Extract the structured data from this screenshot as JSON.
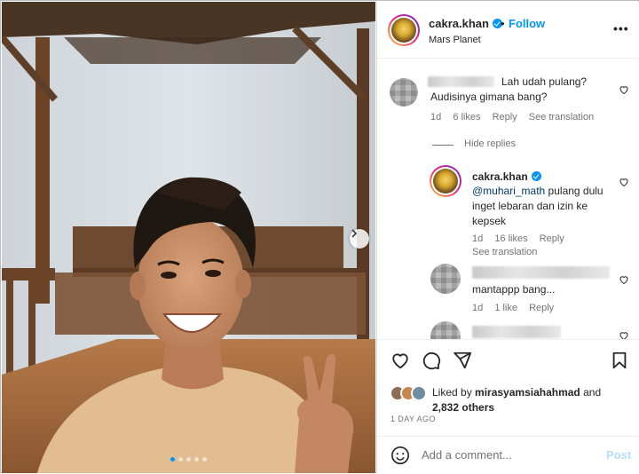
{
  "header": {
    "username": "cakra.khan",
    "separator": "•",
    "follow_label": "Follow",
    "location": "Mars Planet",
    "more_label": "•••"
  },
  "comments": [
    {
      "text": "Lah udah pulang? Audisinya gimana bang?",
      "age": "1d",
      "likes": "6 likes",
      "reply": "Reply",
      "translate": "See translation"
    }
  ],
  "hide_replies": "Hide replies",
  "reply": {
    "username": "cakra.khan",
    "mention": "@muhari_math",
    "text": " pulang dulu inget lebaran dan izin ke kepsek",
    "age": "1d",
    "likes": "16 likes",
    "reply": "Reply",
    "translate": "See translation"
  },
  "comment2": {
    "text": "mantappp bang...",
    "age": "1d",
    "likes": "1 like",
    "reply": "Reply"
  },
  "likes": {
    "prefix": "Liked by ",
    "user": "mirasyamsiahahmad",
    "middle": " and",
    "count": "2,832 others"
  },
  "timestamp": "1 DAY AGO",
  "add_comment": {
    "placeholder": "Add a comment...",
    "post_label": "Post"
  },
  "carousel": {
    "slides": 5,
    "active": 1
  },
  "colors": {
    "accent": "#0095f6",
    "link": "#00376b",
    "muted": "#737373"
  },
  "icons": [
    "more-icon",
    "verified-icon",
    "heart-icon",
    "comment-icon",
    "share-icon",
    "bookmark-icon",
    "emoji-icon",
    "chevron-right-icon"
  ]
}
